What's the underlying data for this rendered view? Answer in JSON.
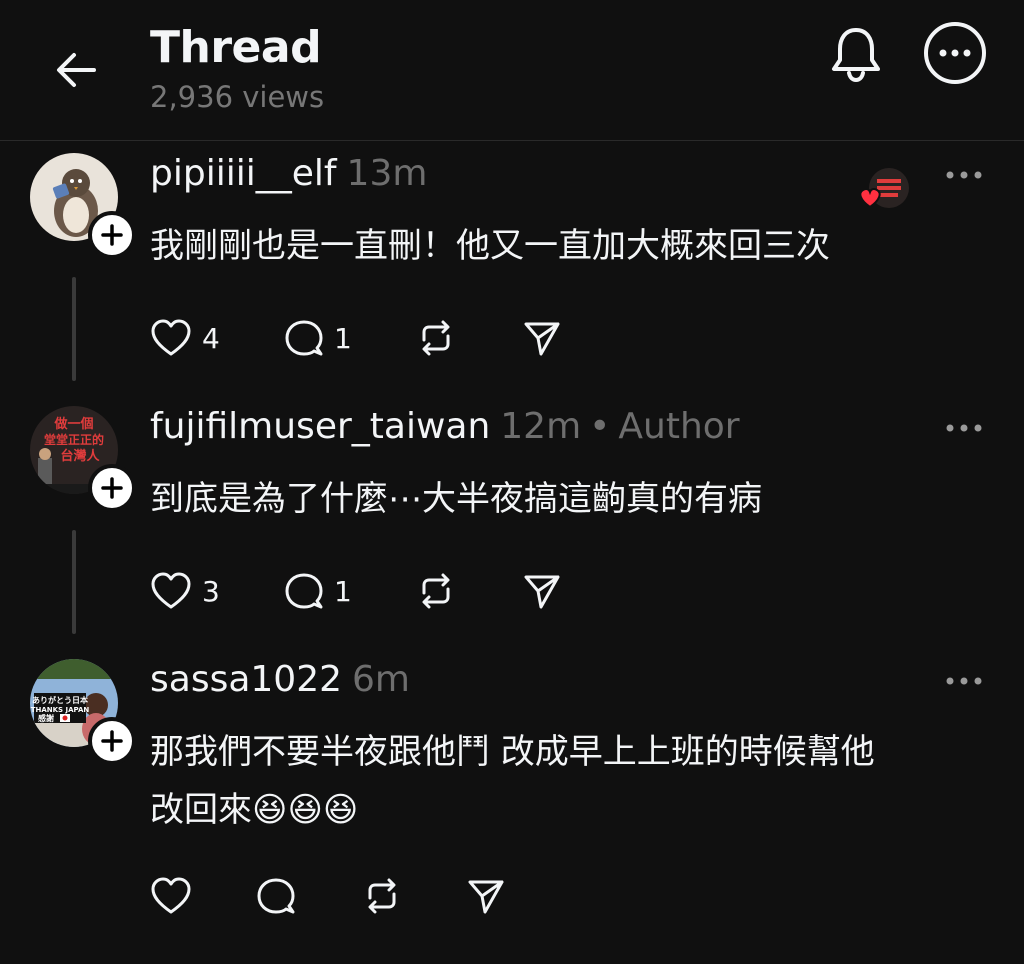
{
  "header": {
    "title": "Thread",
    "views": "2,936 views"
  },
  "comments": [
    {
      "username": "pipiiiii__elf",
      "time": "13m",
      "text": "我剛剛也是一直刪！他又一直加大概來回三次",
      "likes": "4",
      "replies": "1",
      "author_badge": "",
      "liked_by_author": true,
      "avatar_colors": [
        "#e9e3da",
        "#5a4a3c"
      ]
    },
    {
      "username": "fujifilmuser_taiwan",
      "time": "12m",
      "text": "到底是為了什麼⋯大半夜搞這齣真的有病",
      "likes": "3",
      "replies": "1",
      "author_badge": "Author",
      "avatar_text_top": "做一個",
      "avatar_text_mid": "堂堂正正的",
      "avatar_text_bot": "台灣人",
      "avatar_colors": [
        "#2a2322",
        "#e03c3c"
      ]
    },
    {
      "username": "sassa1022",
      "time": "6m",
      "text_line1": "那我們不要半夜跟他鬥 改成早上上班的時候幫他",
      "text_line2": "改回來😆😆😆",
      "likes": "",
      "replies": "",
      "author_badge": "",
      "avatar_text_top": "ありがとう日本",
      "avatar_text_mid": "THANKS JAPAN",
      "avatar_text_bot": "感謝",
      "avatar_colors": [
        "#8fb3d9",
        "#3f5e2e"
      ]
    }
  ]
}
